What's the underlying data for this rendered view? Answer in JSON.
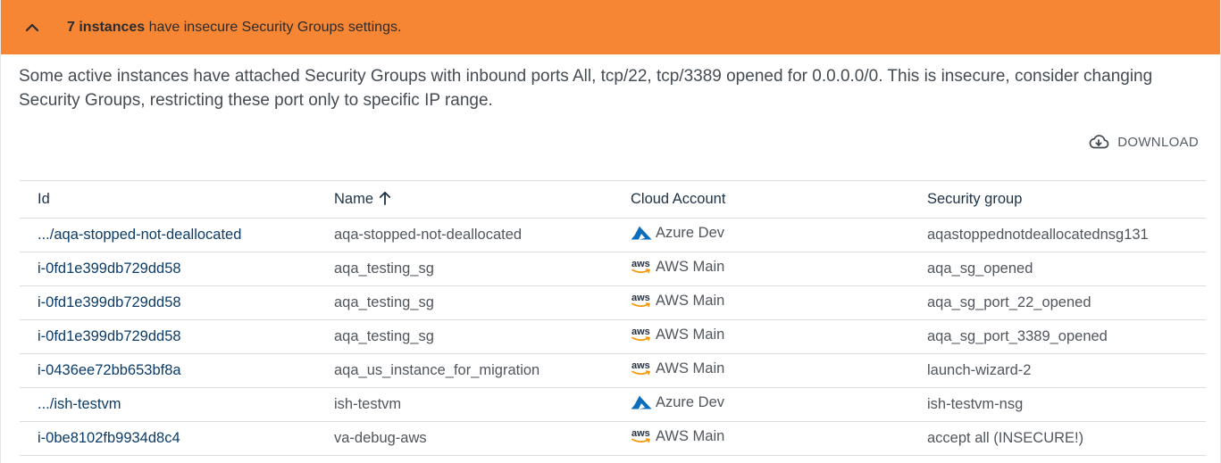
{
  "alert": {
    "count_text": "7 instances",
    "rest_text": " have insecure Security Groups settings.",
    "color": "#f68634"
  },
  "description": "Some active instances have attached Security Groups with inbound ports All, tcp/22, tcp/3389 opened for 0.0.0.0/0. This is insecure, consider changing Security Groups, restricting these port only to specific IP range.",
  "toolbar": {
    "download_label": "DOWNLOAD",
    "download_icon": "cloud-download-icon"
  },
  "table": {
    "columns": [
      "Id",
      "Name",
      "Cloud Account",
      "Security group"
    ],
    "sort": {
      "column": "Name",
      "direction": "ascending",
      "icon": "arrow-up-icon"
    },
    "rows": [
      {
        "id": ".../aqa-stopped-not-deallocated",
        "name": "aqa-stopped-not-deallocated",
        "account": "Azure Dev",
        "provider": "azure",
        "security_group": "aqastoppednotdeallocatednsg131"
      },
      {
        "id": "i-0fd1e399db729dd58",
        "name": "aqa_testing_sg",
        "account": "AWS Main",
        "provider": "aws",
        "security_group": "aqa_sg_opened"
      },
      {
        "id": "i-0fd1e399db729dd58",
        "name": "aqa_testing_sg",
        "account": "AWS Main",
        "provider": "aws",
        "security_group": "aqa_sg_port_22_opened"
      },
      {
        "id": "i-0fd1e399db729dd58",
        "name": "aqa_testing_sg",
        "account": "AWS Main",
        "provider": "aws",
        "security_group": "aqa_sg_port_3389_opened"
      },
      {
        "id": "i-0436ee72bb653bf8a",
        "name": "aqa_us_instance_for_migration",
        "account": "AWS Main",
        "provider": "aws",
        "security_group": "launch-wizard-2"
      },
      {
        "id": ".../ish-testvm",
        "name": "ish-testvm",
        "account": "Azure Dev",
        "provider": "azure",
        "security_group": "ish-testvm-nsg"
      },
      {
        "id": "i-0be8102fb9934d8c4",
        "name": "va-debug-aws",
        "account": "AWS Main",
        "provider": "aws",
        "security_group": "accept all (INSECURE!)"
      }
    ]
  },
  "provider_logos": {
    "aws": {
      "text": "aws",
      "icon": "aws-logo-icon"
    },
    "azure": {
      "icon": "azure-logo-icon",
      "color": "#0a6ebd"
    }
  }
}
